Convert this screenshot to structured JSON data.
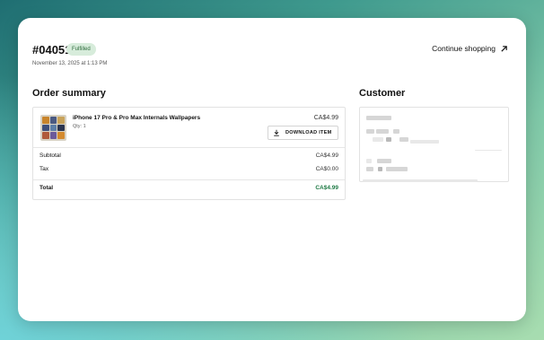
{
  "order": {
    "id": "#04051",
    "status": "Fulfilled",
    "date": "November 13, 2025 at 1:13 PM"
  },
  "header": {
    "continue_label": "Continue shopping"
  },
  "summary": {
    "heading": "Order summary",
    "item": {
      "title": "iPhone 17 Pro & Pro Max Internals Wallpapers",
      "qty": "Qty: 1",
      "price": "CA$4.99",
      "download_label": "DOWNLOAD ITEM"
    },
    "rows": {
      "subtotal_label": "Subtotal",
      "subtotal_value": "CA$4.99",
      "tax_label": "Tax",
      "tax_value": "CA$0.00",
      "total_label": "Total",
      "total_value": "CA$4.99"
    }
  },
  "customer": {
    "heading": "Customer"
  },
  "colors": {
    "accent_total": "#1f7a45",
    "badge_bg": "#d7ecdb"
  },
  "icons": {
    "continue": "arrow-up-right-icon",
    "download": "download-icon"
  }
}
